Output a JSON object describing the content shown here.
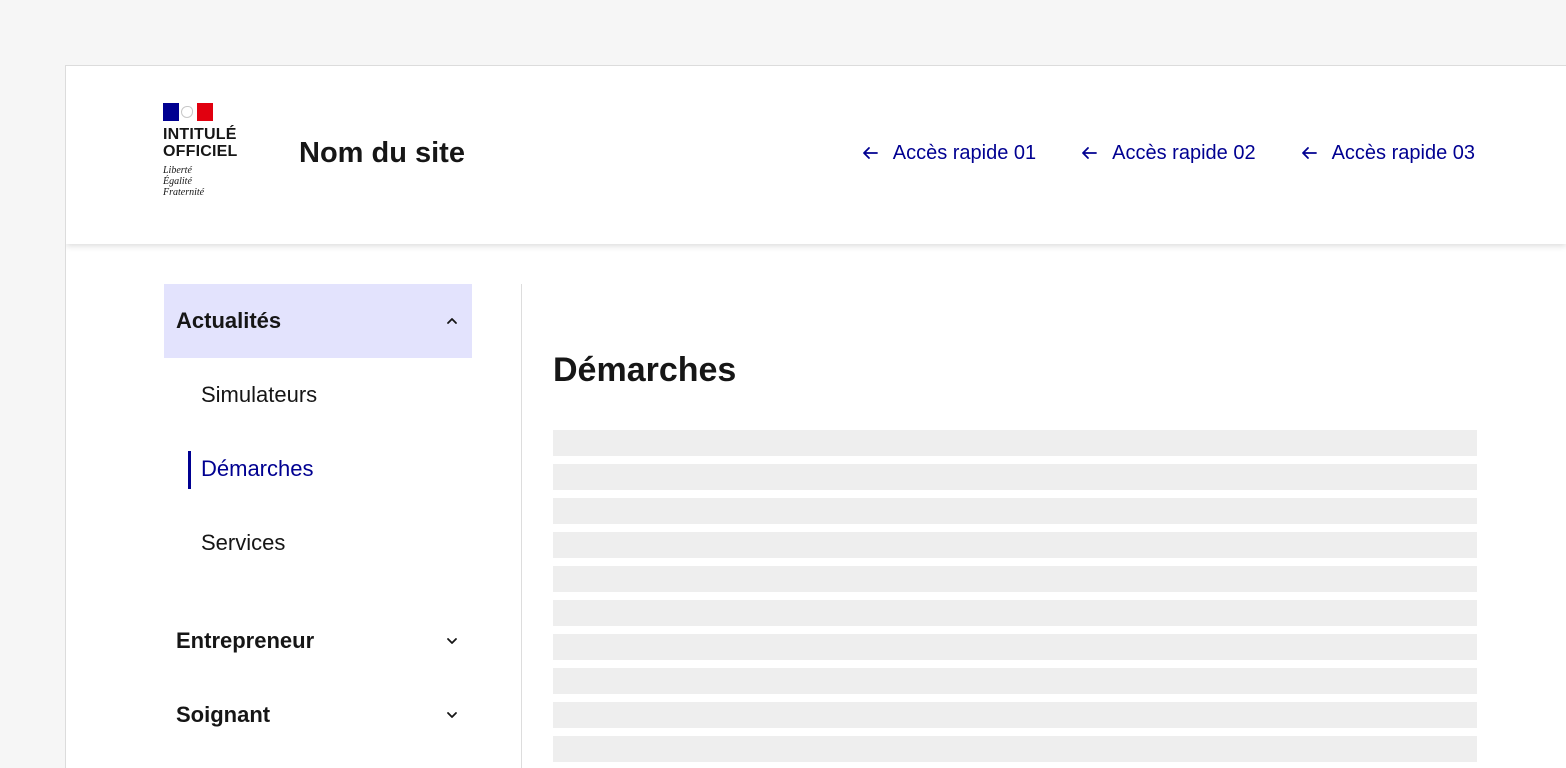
{
  "header": {
    "logo": {
      "line1": "INTITULÉ",
      "line2": "OFFICIEL",
      "motto": [
        "Liberté",
        "Égalité",
        "Fraternité"
      ]
    },
    "site_title": "Nom du site",
    "quick_links": [
      {
        "label": "Accès rapide 01",
        "icon": "arrow-left-icon"
      },
      {
        "label": "Accès rapide 02",
        "icon": "arrow-left-icon"
      },
      {
        "label": "Accès rapide 03",
        "icon": "arrow-left-icon"
      }
    ]
  },
  "sidenav": {
    "sections": [
      {
        "label": "Actualités",
        "expanded": true,
        "icon": "chevron-up-icon",
        "items": [
          {
            "label": "Simulateurs",
            "current": false
          },
          {
            "label": "Démarches",
            "current": true
          },
          {
            "label": "Services",
            "current": false
          }
        ]
      },
      {
        "label": "Entrepreneur",
        "expanded": false,
        "icon": "chevron-down-icon"
      },
      {
        "label": "Soignant",
        "expanded": false,
        "icon": "chevron-down-icon"
      }
    ]
  },
  "main": {
    "title": "Démarches",
    "placeholder_line_count": 10
  },
  "colors": {
    "accent": "#000091",
    "active_bg": "#e3e3fd",
    "placeholder": "#eeeeee",
    "flag_red": "#e1000f"
  }
}
